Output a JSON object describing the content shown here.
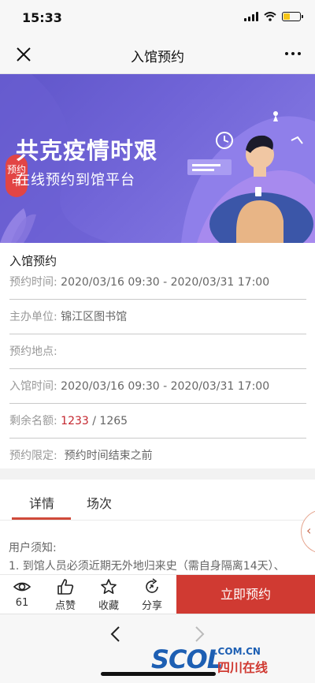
{
  "status_bar": {
    "time": "15:33"
  },
  "nav": {
    "title": "入馆预约"
  },
  "banner": {
    "badge": "预约中",
    "title": "共克疫情时艰",
    "subtitle": "在线预约到馆平台"
  },
  "info": {
    "heading": "入馆预约",
    "rows": [
      {
        "label": "预约时间:",
        "value": "2020/03/16 09:30 - 2020/03/31 17:00"
      },
      {
        "label": "主办单位:",
        "value": "锦江区图书馆"
      },
      {
        "label": "预约地点:",
        "value": ""
      },
      {
        "label": "入馆时间:",
        "value": "2020/03/16 09:30 - 2020/03/31 17:00"
      },
      {
        "label": "剩余名额:",
        "remaining": "1233",
        "total": "/ 1265"
      },
      {
        "label": "预约限定:",
        "value": "预约时间结束之前"
      }
    ]
  },
  "tabs": [
    {
      "label": "详情",
      "active": true
    },
    {
      "label": "场次",
      "active": false
    }
  ],
  "notice": {
    "title": "用户须知:",
    "line1": "1. 到馆人员必须近期无外地归来史（需自身隔离14天）、"
  },
  "side_tab": {
    "glyph": "‹"
  },
  "actions": {
    "views_count": "61",
    "like_label": "点赞",
    "favorite_label": "收藏",
    "share_label": "分享",
    "reserve_label": "立即预约"
  },
  "watermark": {
    "main": "SCOL",
    "domain": ".COM.CN",
    "cn": "四川在线"
  },
  "colors": {
    "accent": "#d03a32",
    "highlight": "#c4262e",
    "banner": "#6f63d6"
  },
  "icons": [
    "close-icon",
    "more-icon",
    "eye-icon",
    "thumb-up-icon",
    "star-icon",
    "share-icon",
    "back-arrow-icon",
    "forward-arrow-icon"
  ]
}
